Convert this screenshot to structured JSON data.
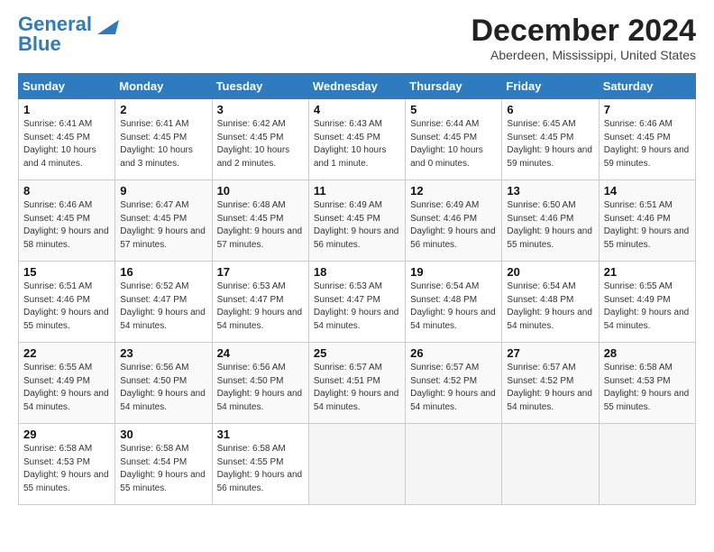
{
  "header": {
    "logo_general": "General",
    "logo_blue": "Blue",
    "month_title": "December 2024",
    "location": "Aberdeen, Mississippi, United States"
  },
  "days_of_week": [
    "Sunday",
    "Monday",
    "Tuesday",
    "Wednesday",
    "Thursday",
    "Friday",
    "Saturday"
  ],
  "weeks": [
    [
      {
        "day": "1",
        "sunrise": "6:41 AM",
        "sunset": "4:45 PM",
        "daylight": "10 hours and 4 minutes."
      },
      {
        "day": "2",
        "sunrise": "6:41 AM",
        "sunset": "4:45 PM",
        "daylight": "10 hours and 3 minutes."
      },
      {
        "day": "3",
        "sunrise": "6:42 AM",
        "sunset": "4:45 PM",
        "daylight": "10 hours and 2 minutes."
      },
      {
        "day": "4",
        "sunrise": "6:43 AM",
        "sunset": "4:45 PM",
        "daylight": "10 hours and 1 minute."
      },
      {
        "day": "5",
        "sunrise": "6:44 AM",
        "sunset": "4:45 PM",
        "daylight": "10 hours and 0 minutes."
      },
      {
        "day": "6",
        "sunrise": "6:45 AM",
        "sunset": "4:45 PM",
        "daylight": "9 hours and 59 minutes."
      },
      {
        "day": "7",
        "sunrise": "6:46 AM",
        "sunset": "4:45 PM",
        "daylight": "9 hours and 59 minutes."
      }
    ],
    [
      {
        "day": "8",
        "sunrise": "6:46 AM",
        "sunset": "4:45 PM",
        "daylight": "9 hours and 58 minutes."
      },
      {
        "day": "9",
        "sunrise": "6:47 AM",
        "sunset": "4:45 PM",
        "daylight": "9 hours and 57 minutes."
      },
      {
        "day": "10",
        "sunrise": "6:48 AM",
        "sunset": "4:45 PM",
        "daylight": "9 hours and 57 minutes."
      },
      {
        "day": "11",
        "sunrise": "6:49 AM",
        "sunset": "4:45 PM",
        "daylight": "9 hours and 56 minutes."
      },
      {
        "day": "12",
        "sunrise": "6:49 AM",
        "sunset": "4:46 PM",
        "daylight": "9 hours and 56 minutes."
      },
      {
        "day": "13",
        "sunrise": "6:50 AM",
        "sunset": "4:46 PM",
        "daylight": "9 hours and 55 minutes."
      },
      {
        "day": "14",
        "sunrise": "6:51 AM",
        "sunset": "4:46 PM",
        "daylight": "9 hours and 55 minutes."
      }
    ],
    [
      {
        "day": "15",
        "sunrise": "6:51 AM",
        "sunset": "4:46 PM",
        "daylight": "9 hours and 55 minutes."
      },
      {
        "day": "16",
        "sunrise": "6:52 AM",
        "sunset": "4:47 PM",
        "daylight": "9 hours and 54 minutes."
      },
      {
        "day": "17",
        "sunrise": "6:53 AM",
        "sunset": "4:47 PM",
        "daylight": "9 hours and 54 minutes."
      },
      {
        "day": "18",
        "sunrise": "6:53 AM",
        "sunset": "4:47 PM",
        "daylight": "9 hours and 54 minutes."
      },
      {
        "day": "19",
        "sunrise": "6:54 AM",
        "sunset": "4:48 PM",
        "daylight": "9 hours and 54 minutes."
      },
      {
        "day": "20",
        "sunrise": "6:54 AM",
        "sunset": "4:48 PM",
        "daylight": "9 hours and 54 minutes."
      },
      {
        "day": "21",
        "sunrise": "6:55 AM",
        "sunset": "4:49 PM",
        "daylight": "9 hours and 54 minutes."
      }
    ],
    [
      {
        "day": "22",
        "sunrise": "6:55 AM",
        "sunset": "4:49 PM",
        "daylight": "9 hours and 54 minutes."
      },
      {
        "day": "23",
        "sunrise": "6:56 AM",
        "sunset": "4:50 PM",
        "daylight": "9 hours and 54 minutes."
      },
      {
        "day": "24",
        "sunrise": "6:56 AM",
        "sunset": "4:50 PM",
        "daylight": "9 hours and 54 minutes."
      },
      {
        "day": "25",
        "sunrise": "6:57 AM",
        "sunset": "4:51 PM",
        "daylight": "9 hours and 54 minutes."
      },
      {
        "day": "26",
        "sunrise": "6:57 AM",
        "sunset": "4:52 PM",
        "daylight": "9 hours and 54 minutes."
      },
      {
        "day": "27",
        "sunrise": "6:57 AM",
        "sunset": "4:52 PM",
        "daylight": "9 hours and 54 minutes."
      },
      {
        "day": "28",
        "sunrise": "6:58 AM",
        "sunset": "4:53 PM",
        "daylight": "9 hours and 55 minutes."
      }
    ],
    [
      {
        "day": "29",
        "sunrise": "6:58 AM",
        "sunset": "4:53 PM",
        "daylight": "9 hours and 55 minutes."
      },
      {
        "day": "30",
        "sunrise": "6:58 AM",
        "sunset": "4:54 PM",
        "daylight": "9 hours and 55 minutes."
      },
      {
        "day": "31",
        "sunrise": "6:58 AM",
        "sunset": "4:55 PM",
        "daylight": "9 hours and 56 minutes."
      },
      null,
      null,
      null,
      null
    ]
  ]
}
